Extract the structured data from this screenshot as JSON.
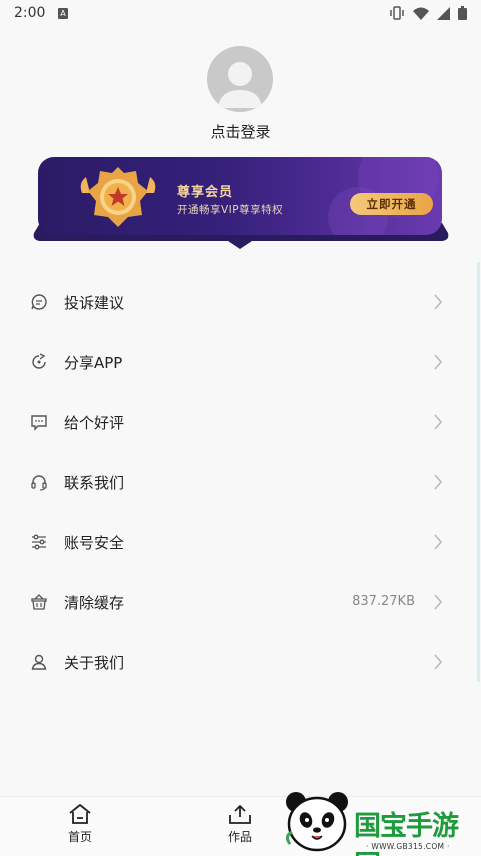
{
  "status_bar": {
    "time": "2:00",
    "a_badge": "A"
  },
  "profile": {
    "login_text": "点击登录"
  },
  "vip": {
    "title": "尊享会员",
    "subtitle": "开通畅享VIP尊享特权",
    "button": "立即开通",
    "colors": {
      "bg_start": "#2b1b66",
      "bg_end": "#6b3bb0",
      "gold": "#f4c97a"
    }
  },
  "menu": {
    "items": [
      {
        "label": "投诉建议",
        "icon": "feedback-icon",
        "value": ""
      },
      {
        "label": "分享APP",
        "icon": "share-icon",
        "value": ""
      },
      {
        "label": "给个好评",
        "icon": "rate-icon",
        "value": ""
      },
      {
        "label": "联系我们",
        "icon": "headset-icon",
        "value": ""
      },
      {
        "label": "账号安全",
        "icon": "sliders-icon",
        "value": ""
      },
      {
        "label": "清除缓存",
        "icon": "basket-icon",
        "value": "837.27KB"
      },
      {
        "label": "关于我们",
        "icon": "person-icon",
        "value": ""
      }
    ]
  },
  "tabbar": {
    "home": {
      "label": "首页",
      "icon": "home-icon"
    },
    "works": {
      "label": "作品",
      "icon": "upload-tray-icon"
    }
  },
  "watermark": {
    "text": "国宝手游网",
    "url": "· WWW.GB315.COM ·"
  }
}
